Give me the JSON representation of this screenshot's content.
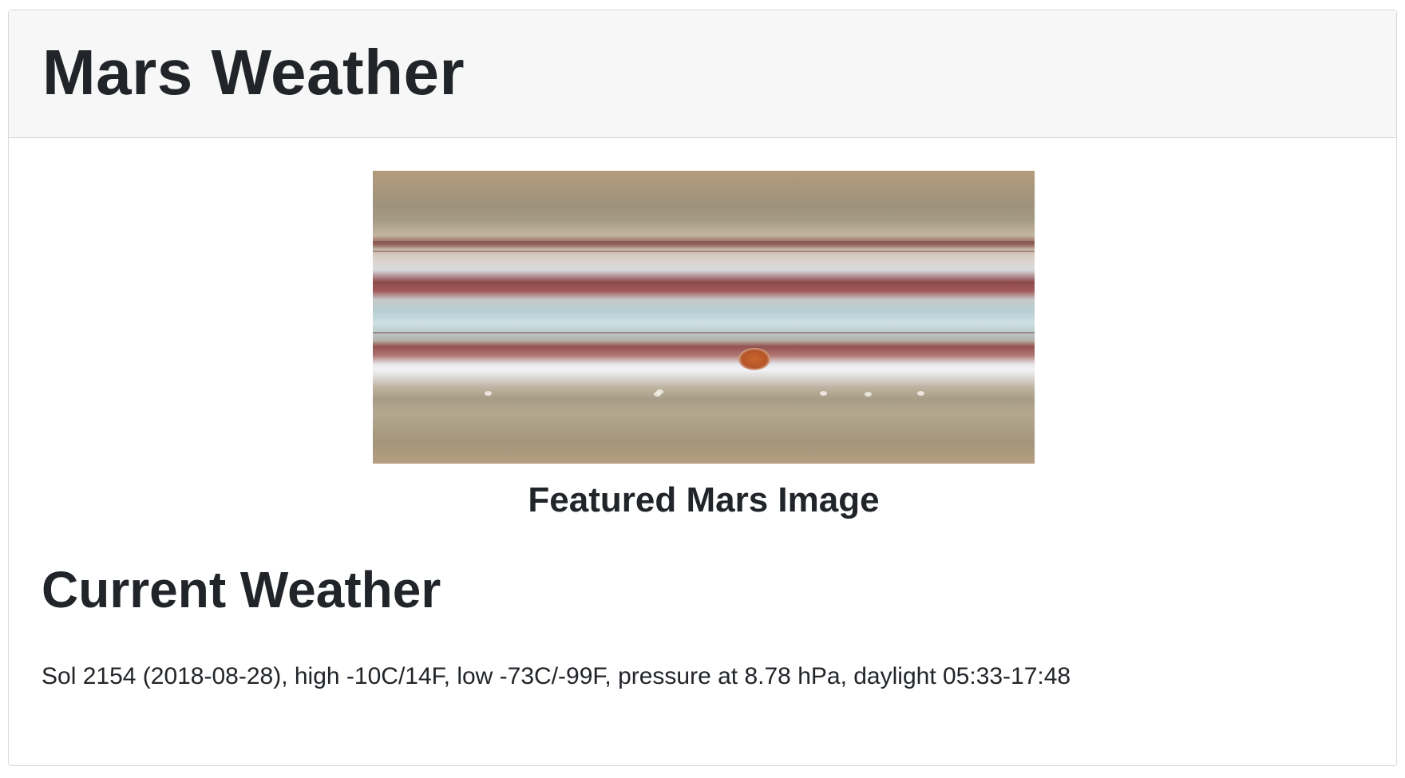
{
  "page": {
    "title": "Mars Weather"
  },
  "featured": {
    "image_alt": "Featured Mars Image",
    "caption": "Featured Mars Image"
  },
  "weather": {
    "heading": "Current Weather",
    "report": "Sol 2154 (2018-08-28), high -10C/14F, low -73C/-99F, pressure at 8.78 hPa, daylight 05:33-17:48"
  },
  "colors": {
    "text": "#212529",
    "header_background": "#f7f7f7",
    "border": "#d9d9d9"
  }
}
